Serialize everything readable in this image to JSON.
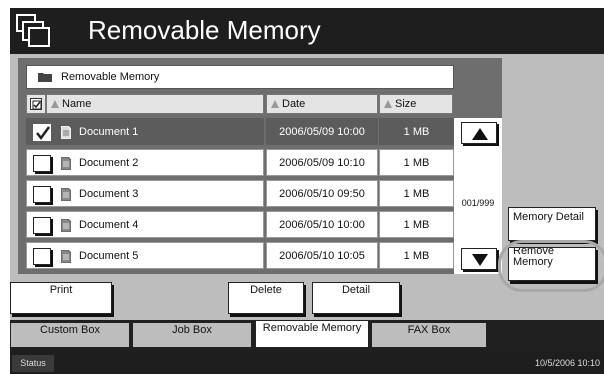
{
  "title": "Removable Memory",
  "path": "Removable Memory",
  "columns": {
    "name": "Name",
    "date": "Date",
    "size": "Size"
  },
  "rows": [
    {
      "name": "Document 1",
      "date": "2006/05/09 10:00",
      "size": "1 MB",
      "checked": true
    },
    {
      "name": "Document 2",
      "date": "2006/05/09 10:10",
      "size": "1 MB",
      "checked": false
    },
    {
      "name": "Document 3",
      "date": "2006/05/10 09:50",
      "size": "1 MB",
      "checked": false
    },
    {
      "name": "Document 4",
      "date": "2006/05/10 10:00",
      "size": "1 MB",
      "checked": false
    },
    {
      "name": "Document 5",
      "date": "2006/05/10 10:05",
      "size": "1 MB",
      "checked": false
    }
  ],
  "page_indicator": "001/999",
  "side_buttons": {
    "memory_detail": "Memory Detail",
    "remove_memory": "Remove Memory"
  },
  "bottom_buttons": {
    "print": "Print",
    "delete": "Delete",
    "detail": "Detail"
  },
  "tabs": [
    "Custom Box",
    "Job Box",
    "Removable Memory",
    "FAX Box"
  ],
  "active_tab": "Removable Memory",
  "status": "Status",
  "datetime": "10/5/2006   10:10",
  "colors": {
    "title_bar": "#1e1e1e",
    "panel": "#bdbdbd",
    "list_bg": "#6e6e6e",
    "selected_row": "#5c5c5c"
  },
  "icons": [
    "removable-box-icon",
    "folder-icon",
    "sort-arrow-icon",
    "checkbox-icon",
    "document-icon",
    "scroll-up-icon",
    "scroll-down-icon"
  ]
}
